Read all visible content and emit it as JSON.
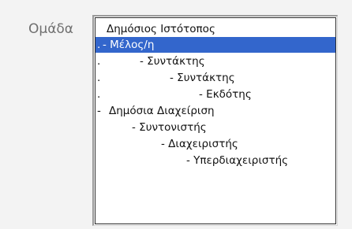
{
  "field": {
    "label": "Ομάδα"
  },
  "listbox": {
    "selected_index": 1,
    "options": [
      {
        "lead": "",
        "text": "Δημόσιος Ιστότοπος"
      },
      {
        "lead": ".",
        "text": "- Μέλος/η"
      },
      {
        "lead": ".",
        "text": "- Συντάκτης"
      },
      {
        "lead": ".",
        "text": "- Συντάκτης"
      },
      {
        "lead": ".",
        "text": "- Εκδότης"
      },
      {
        "lead": "-",
        "text": "Δημόσια Διαχείριση"
      },
      {
        "lead": "",
        "text": "- Συντονιστής"
      },
      {
        "lead": "",
        "text": "- Διαχειριστής"
      },
      {
        "lead": "",
        "text": "- Υπερδιαχειριστής"
      }
    ]
  },
  "colors": {
    "selected_background": "#3366cc",
    "selected_text": "#ffffff",
    "label_text": "#6f6f6f"
  }
}
